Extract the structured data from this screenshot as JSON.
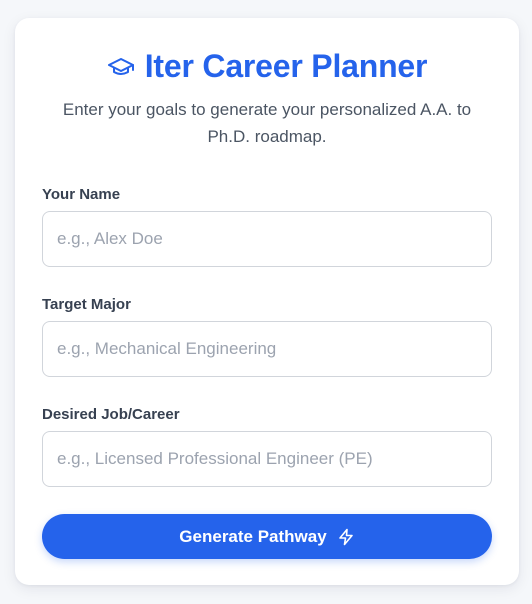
{
  "header": {
    "icon": "graduation-cap-icon",
    "title": "Iter Career Planner",
    "subtitle": "Enter your goals to generate your personalized A.A. to Ph.D. roadmap."
  },
  "form": {
    "name": {
      "label": "Your Name",
      "placeholder": "e.g., Alex Doe",
      "value": ""
    },
    "major": {
      "label": "Target Major",
      "placeholder": "e.g., Mechanical Engineering",
      "value": ""
    },
    "career": {
      "label": "Desired Job/Career",
      "placeholder": "e.g., Licensed Professional Engineer (PE)",
      "value": ""
    }
  },
  "submit": {
    "label": "Generate Pathway",
    "icon": "lightning-bolt-icon"
  },
  "colors": {
    "accent": "#2563eb",
    "background": "#f5f7fa",
    "card": "#ffffff",
    "input_border": "#d1d5db",
    "placeholder": "#9ca3af"
  }
}
